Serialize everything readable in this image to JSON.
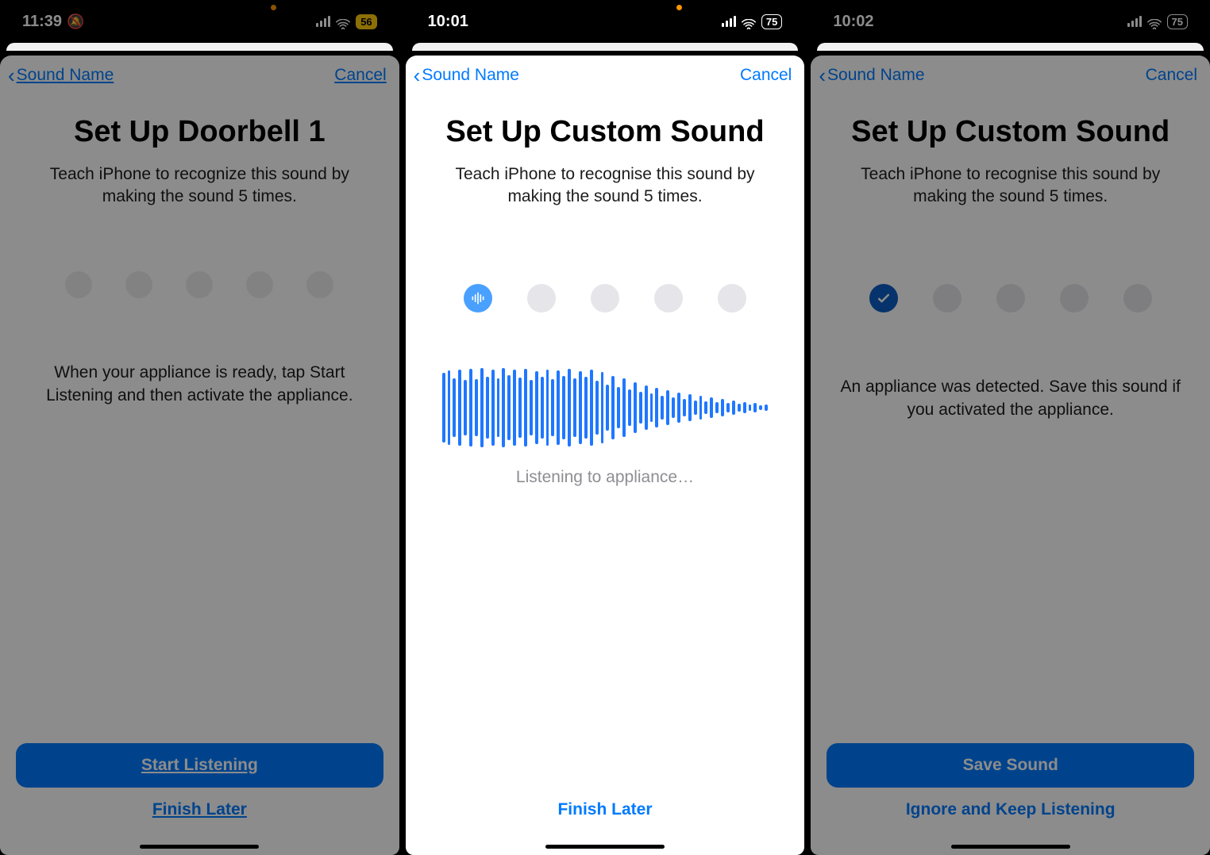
{
  "screens": [
    {
      "status": {
        "time": "11:39",
        "bell_off": true,
        "battery": "56",
        "battery_style": "yellow"
      },
      "nav": {
        "back": "Sound Name",
        "cancel": "Cancel",
        "underline": true
      },
      "title": "Set Up Doorbell 1",
      "subtitle": "Teach iPhone to recognize this sound by making the sound 5 times.",
      "dots": {
        "count": 5,
        "state": "none"
      },
      "mid_text": "When your appliance is ready, tap Start Listening and then activate the appliance.",
      "primary": "Start Listening",
      "secondary": "Finish Later"
    },
    {
      "status": {
        "time": "10:01",
        "bell_off": false,
        "battery": "75",
        "battery_style": "white"
      },
      "nav": {
        "back": "Sound Name",
        "cancel": "Cancel",
        "underline": false
      },
      "title": "Set Up Custom Sound",
      "subtitle": "Teach iPhone to recognise this sound by making the sound 5 times.",
      "dots": {
        "count": 5,
        "state": "wave"
      },
      "listening_label": "Listening to appliance…",
      "secondary": "Finish Later"
    },
    {
      "status": {
        "time": "10:02",
        "bell_off": false,
        "battery": "75",
        "battery_style": "white"
      },
      "nav": {
        "back": "Sound Name",
        "cancel": "Cancel",
        "underline": false
      },
      "title": "Set Up Custom Sound",
      "subtitle": "Teach iPhone to recognise this sound by making the sound 5 times.",
      "dots": {
        "count": 5,
        "state": "check"
      },
      "mid_text": "An appliance was detected. Save this sound if you activated the appliance.",
      "primary": "Save Sound",
      "secondary": "Ignore and Keep Listening"
    }
  ],
  "waveform_heights": [
    88,
    94,
    74,
    96,
    70,
    98,
    72,
    100,
    78,
    96,
    74,
    100,
    82,
    96,
    76,
    98,
    70,
    92,
    78,
    96,
    72,
    94,
    80,
    98,
    74,
    92,
    78,
    96,
    68,
    90,
    58,
    80,
    52,
    74,
    46,
    64,
    40,
    56,
    36,
    50,
    30,
    44,
    26,
    38,
    22,
    34,
    18,
    30,
    16,
    26,
    14,
    22,
    12,
    18,
    10,
    14,
    8,
    12,
    6,
    8
  ]
}
